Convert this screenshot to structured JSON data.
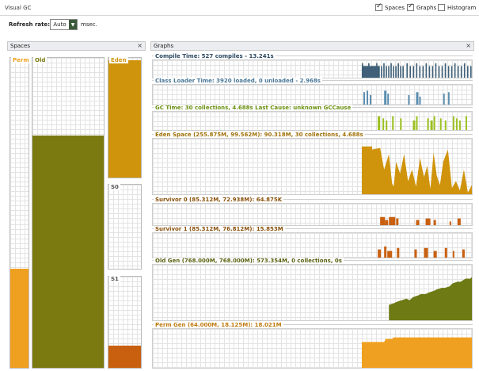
{
  "window": {
    "title": "Visual GC"
  },
  "view_options": [
    {
      "label": "Spaces",
      "checked": true
    },
    {
      "label": "Graphs",
      "checked": true
    },
    {
      "label": "Histogram",
      "checked": false
    }
  ],
  "toolbar": {
    "refresh_label": "Refresh rate:",
    "refresh_value": "Auto",
    "unit": "msec."
  },
  "spaces_panel": {
    "title": "Spaces",
    "close": "×"
  },
  "graphs_panel": {
    "title": "Graphs",
    "close": "×"
  },
  "spaces": {
    "perm": {
      "label": "Perm",
      "color": "#f0a020",
      "fill_ratio": 0.32
    },
    "old": {
      "label": "Old",
      "color": "#7a7a10",
      "fill_ratio": 0.75
    },
    "eden": {
      "label": "Eden",
      "color": "#d0940c",
      "fill_ratio": 0.98
    },
    "s0": {
      "label": "S0",
      "color": "#c86010",
      "fill_ratio": 0.0
    },
    "s1": {
      "label": "S1",
      "color": "#c86010",
      "fill_ratio": 0.24
    }
  },
  "graphs": [
    {
      "key": "compile",
      "label": "Compile Time: 527 compiles - 13.241s",
      "color": "#3f6078",
      "label_color": "#2a4860"
    },
    {
      "key": "classloader",
      "label": "Class Loader Time: 3920 loaded, 0 unloaded - 2.968s",
      "color": "#5c8fb0",
      "label_color": "#4a7898"
    },
    {
      "key": "gctime",
      "label": "GC Time: 30 collections, 4.688s  Last Cause: unknown GCCause",
      "color": "#9cc020",
      "label_color": "#6a9010"
    },
    {
      "key": "eden",
      "label": "Eden Space (255.875M, 99.562M): 90.318M, 30 collections, 4.688s",
      "color": "#d0940c",
      "label_color": "#a07008"
    },
    {
      "key": "s0",
      "label": "Survivor 0 (85.312M, 72.938M): 64.875K",
      "color": "#c86010",
      "label_color": "#8a5008"
    },
    {
      "key": "s1",
      "label": "Survivor 1 (85.312M, 76.812M): 15.853M",
      "color": "#c86010",
      "label_color": "#8a5008"
    },
    {
      "key": "oldgen",
      "label": "Old Gen (768.000M, 768.000M): 573.354M, 0 collections, 0s",
      "color": "#6e7a14",
      "label_color": "#5a6010"
    },
    {
      "key": "permgen",
      "label": "Perm Gen (64.000M, 18.125M): 18.021M",
      "color": "#f0a020",
      "label_color": "#c07a10"
    }
  ]
}
